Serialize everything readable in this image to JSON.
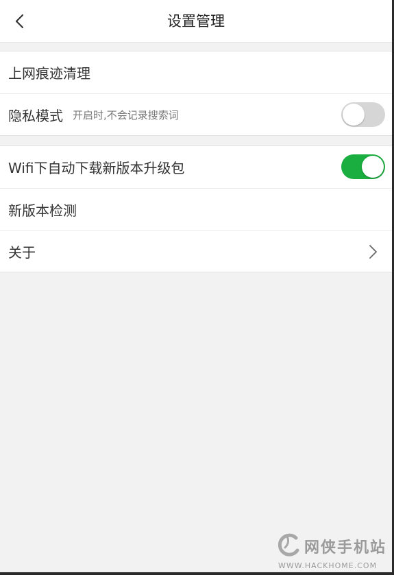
{
  "header": {
    "title": "设置管理",
    "back_icon": "chevron-left-icon"
  },
  "group1": {
    "items": [
      {
        "label": "上网痕迹清理"
      },
      {
        "label": "隐私模式",
        "sublabel": "开启时,不会记录搜索词",
        "toggle": "off"
      }
    ]
  },
  "group2": {
    "items": [
      {
        "label": "Wifi下自动下载新版本升级包",
        "toggle": "on"
      },
      {
        "label": "新版本检测"
      },
      {
        "label": "关于",
        "icon": "chevron-right-icon"
      }
    ]
  },
  "watermark": {
    "text": "网侠手机站",
    "url": "WWW.HACKHOME.COM"
  },
  "colors": {
    "toggle_on": "#1aad3f",
    "toggle_off": "#d6d6d6",
    "background": "#f2f2f2"
  }
}
